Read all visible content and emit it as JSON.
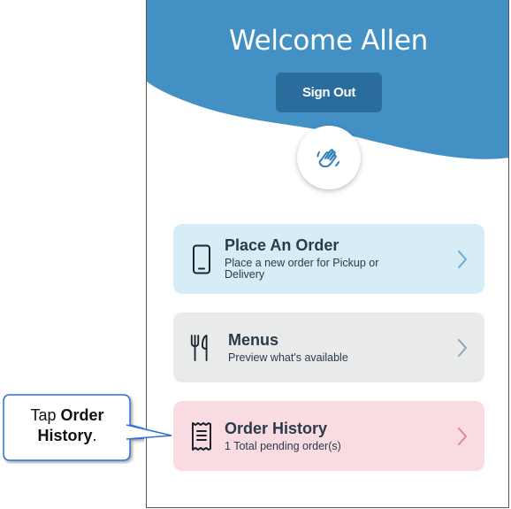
{
  "header": {
    "welcome": "Welcome Allen",
    "sign_out_label": "Sign Out",
    "badge_icon": "waving-hand-icon"
  },
  "cards": [
    {
      "title": "Place An Order",
      "subtitle": "Place a new order for Pickup or Delivery",
      "icon": "smartphone-icon"
    },
    {
      "title": "Menus",
      "subtitle": "Preview what's available",
      "icon": "fork-knife-icon"
    },
    {
      "title": "Order History",
      "subtitle": "1 Total pending order(s)",
      "icon": "receipt-icon"
    }
  ],
  "callout": {
    "prefix": "Tap ",
    "bold": "Order History",
    "suffix": "."
  },
  "colors": {
    "hero_blue": "#4390c4",
    "sign_out_bg": "#2a6d9c",
    "card_order_bg": "#d6edf6",
    "card_menus_bg": "#e9eaea",
    "card_history_bg": "#f8dce1",
    "chevron_blue": "#6aaad4",
    "chevron_gray": "#8fa3b4",
    "chevron_pink": "#d98a9a"
  }
}
